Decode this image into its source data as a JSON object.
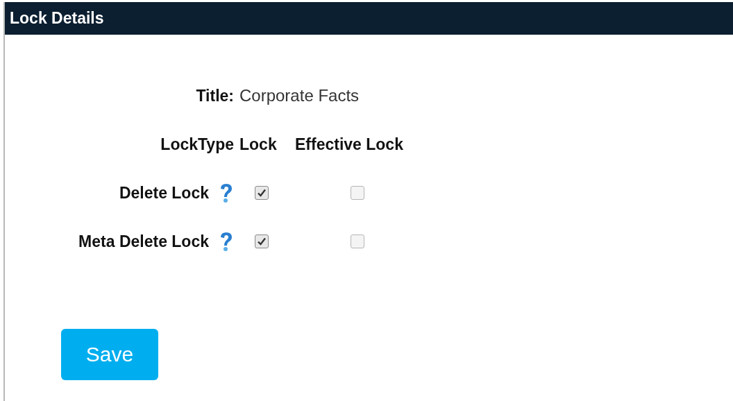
{
  "panel": {
    "title": "Lock Details"
  },
  "title_field": {
    "label": "Title:",
    "value": "Corporate Facts"
  },
  "columns": [
    "LockType",
    "Lock",
    "Effective Lock"
  ],
  "locks": [
    {
      "name": "Delete Lock",
      "lock_checked": true,
      "effective_checked": false
    },
    {
      "name": "Meta Delete Lock",
      "lock_checked": true,
      "effective_checked": false
    }
  ],
  "buttons": [
    "Save"
  ]
}
